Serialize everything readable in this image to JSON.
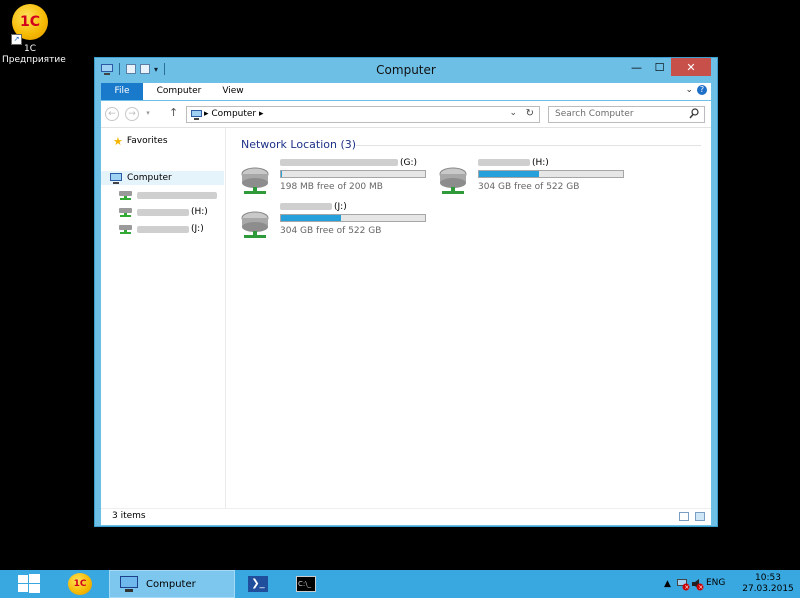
{
  "desktop": {
    "shortcut_1c": {
      "logo_text": "1С",
      "label_line1": "1С",
      "label_line2": "Предприятие"
    }
  },
  "window": {
    "title": "Computer",
    "ribbon_tabs": [
      "File",
      "Computer",
      "View"
    ],
    "address_path": "Computer",
    "search_placeholder": "Search Computer",
    "nav_pane": {
      "favorites": "Favorites",
      "computer": "Computer",
      "drives": [
        {
          "letter": ""
        },
        {
          "letter": "(H:)"
        },
        {
          "letter": "(J:)"
        }
      ]
    },
    "group_header": "Network Location (3)",
    "drives": [
      {
        "letter": "(G:)",
        "free_text": "198 MB free of 200 MB",
        "used_fraction": 0.01,
        "bar_color": "#26a0da"
      },
      {
        "letter": "(H:)",
        "free_text": "304 GB free of 522 GB",
        "used_fraction": 0.42,
        "bar_color": "#26a0da"
      },
      {
        "letter": "(J:)",
        "free_text": "304 GB free of 522 GB",
        "used_fraction": 0.42,
        "bar_color": "#26a0da"
      }
    ],
    "status_text": "3 items"
  },
  "taskbar": {
    "active_window_label": "Computer",
    "language": "ENG",
    "time": "10:53",
    "date": "27.03.2015",
    "accent_color": "#3aa8e0"
  }
}
